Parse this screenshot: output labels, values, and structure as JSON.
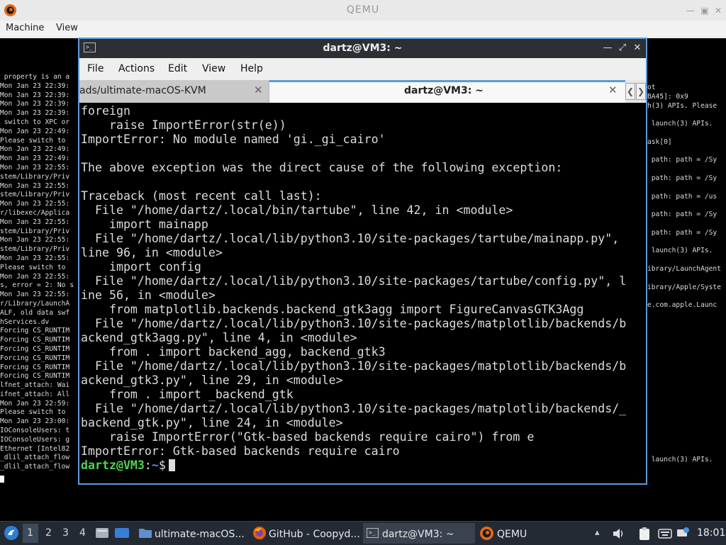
{
  "qemu": {
    "title": "QEMU",
    "menu": [
      "Machine",
      "View"
    ]
  },
  "console_left": [
    " property is an a",
    "Mon Jan 23 22:39:",
    "Mon Jan 23 22:39:",
    "Mon Jan 23 22:39:",
    "Mon Jan 23 22:39:",
    " switch to XPC or",
    "Mon Jan 23 22:49:",
    "Please switch to",
    "Mon Jan 23 22:49:",
    "Mon Jan 23 22:49:",
    "Mon Jan 23 22:55:",
    "stem/Library/Priv",
    "Mon Jan 23 22:55:",
    "stem/Library/Priv",
    "Mon Jan 23 22:55:",
    "r/libexec/Applica",
    "Mon Jan 23 22:55:",
    "stem/Library/Priv",
    "Mon Jan 23 22:55:",
    "stem/Library/Priv",
    "Mon Jan 23 22:55:",
    "Please switch to",
    "Mon Jan 23 22:55:",
    "s, error = 2: No s",
    "Mon Jan 23 22:55:",
    "r/Library/LaunchA",
    "ALF, old data swf",
    "hServices.dv",
    "Forcing CS_RUNTIM",
    "Forcing CS_RUNTIM",
    "Forcing CS_RUNTIM",
    "Forcing CS_RUNTIM",
    "Forcing CS_RUNTIM",
    "Forcing CS_RUNTIM",
    "lfnet_attach: Wai",
    "ifnet_attach: All",
    "Mon Jan 23 22:59:",
    "Please switch to",
    "Mon Jan 23 23:00:",
    "IOConsoleUsers: t",
    "IOConsoleUsers: g",
    "Ethernet [Intel82",
    "_dlil_attach_flow",
    "_dlil_attach_flow"
  ],
  "console_right": [
    "ot",
    "BA45]: 0x9",
    "h(3) APIs. Please",
    "",
    " launch(3) APIs.",
    "",
    "ask[0]",
    "",
    " path: path = /Sy",
    "",
    " path: path = /Sy",
    "",
    " path: path = /us",
    "",
    " path: path = /Sy",
    "",
    " path: path = /Sy",
    "",
    " launch(3) APIs.",
    "",
    "ibrary/LaunchAgent",
    "",
    "ibrary/Apple/Syste",
    "",
    "e.com.apple.Launc",
    "",
    "",
    "",
    "",
    "",
    "",
    "",
    "",
    "",
    "",
    "",
    "",
    "",
    "",
    "",
    "",
    " launch(3) APIs."
  ],
  "terminal": {
    "title": "dartz@VM3: ~",
    "menu": [
      "File",
      "Actions",
      "Edit",
      "View",
      "Help"
    ],
    "tabs": [
      {
        "label": "ads/ultimate-macOS-KVM"
      },
      {
        "label": "dartz@VM3: ~"
      }
    ],
    "lines": [
      "foreign",
      "    raise ImportError(str(e))",
      "ImportError: No module named 'gi._gi_cairo'",
      "",
      "The above exception was the direct cause of the following exception:",
      "",
      "Traceback (most recent call last):",
      "  File \"/home/dartz/.local/bin/tartube\", line 42, in <module>",
      "    import mainapp",
      "  File \"/home/dartz/.local/lib/python3.10/site-packages/tartube/mainapp.py\",",
      "line 96, in <module>",
      "    import config",
      "  File \"/home/dartz/.local/lib/python3.10/site-packages/tartube/config.py\", l",
      "ine 56, in <module>",
      "    from matplotlib.backends.backend_gtk3agg import FigureCanvasGTK3Agg",
      "  File \"/home/dartz/.local/lib/python3.10/site-packages/matplotlib/backends/b",
      "ackend_gtk3agg.py\", line 4, in <module>",
      "    from . import backend_agg, backend_gtk3",
      "  File \"/home/dartz/.local/lib/python3.10/site-packages/matplotlib/backends/b",
      "ackend_gtk3.py\", line 29, in <module>",
      "    from . import _backend_gtk",
      "  File \"/home/dartz/.local/lib/python3.10/site-packages/matplotlib/backends/_",
      "backend_gtk.py\", line 24, in <module>",
      "    raise ImportError(\"Gtk-based backends require cairo\") from e",
      "ImportError: Gtk-based backends require cairo"
    ],
    "prompt": {
      "user": "dartz@VM3",
      "sep": ":",
      "dir": "~",
      "symbol": "$"
    }
  },
  "taskbar": {
    "workspaces": [
      "1",
      "2",
      "3",
      "4"
    ],
    "tasks": [
      {
        "label": "ultimate-macOS..."
      },
      {
        "label": "GitHub - Coopyd..."
      },
      {
        "label": "dartz@VM3: ~"
      },
      {
        "label": "QEMU"
      }
    ],
    "clock": "18:01"
  }
}
